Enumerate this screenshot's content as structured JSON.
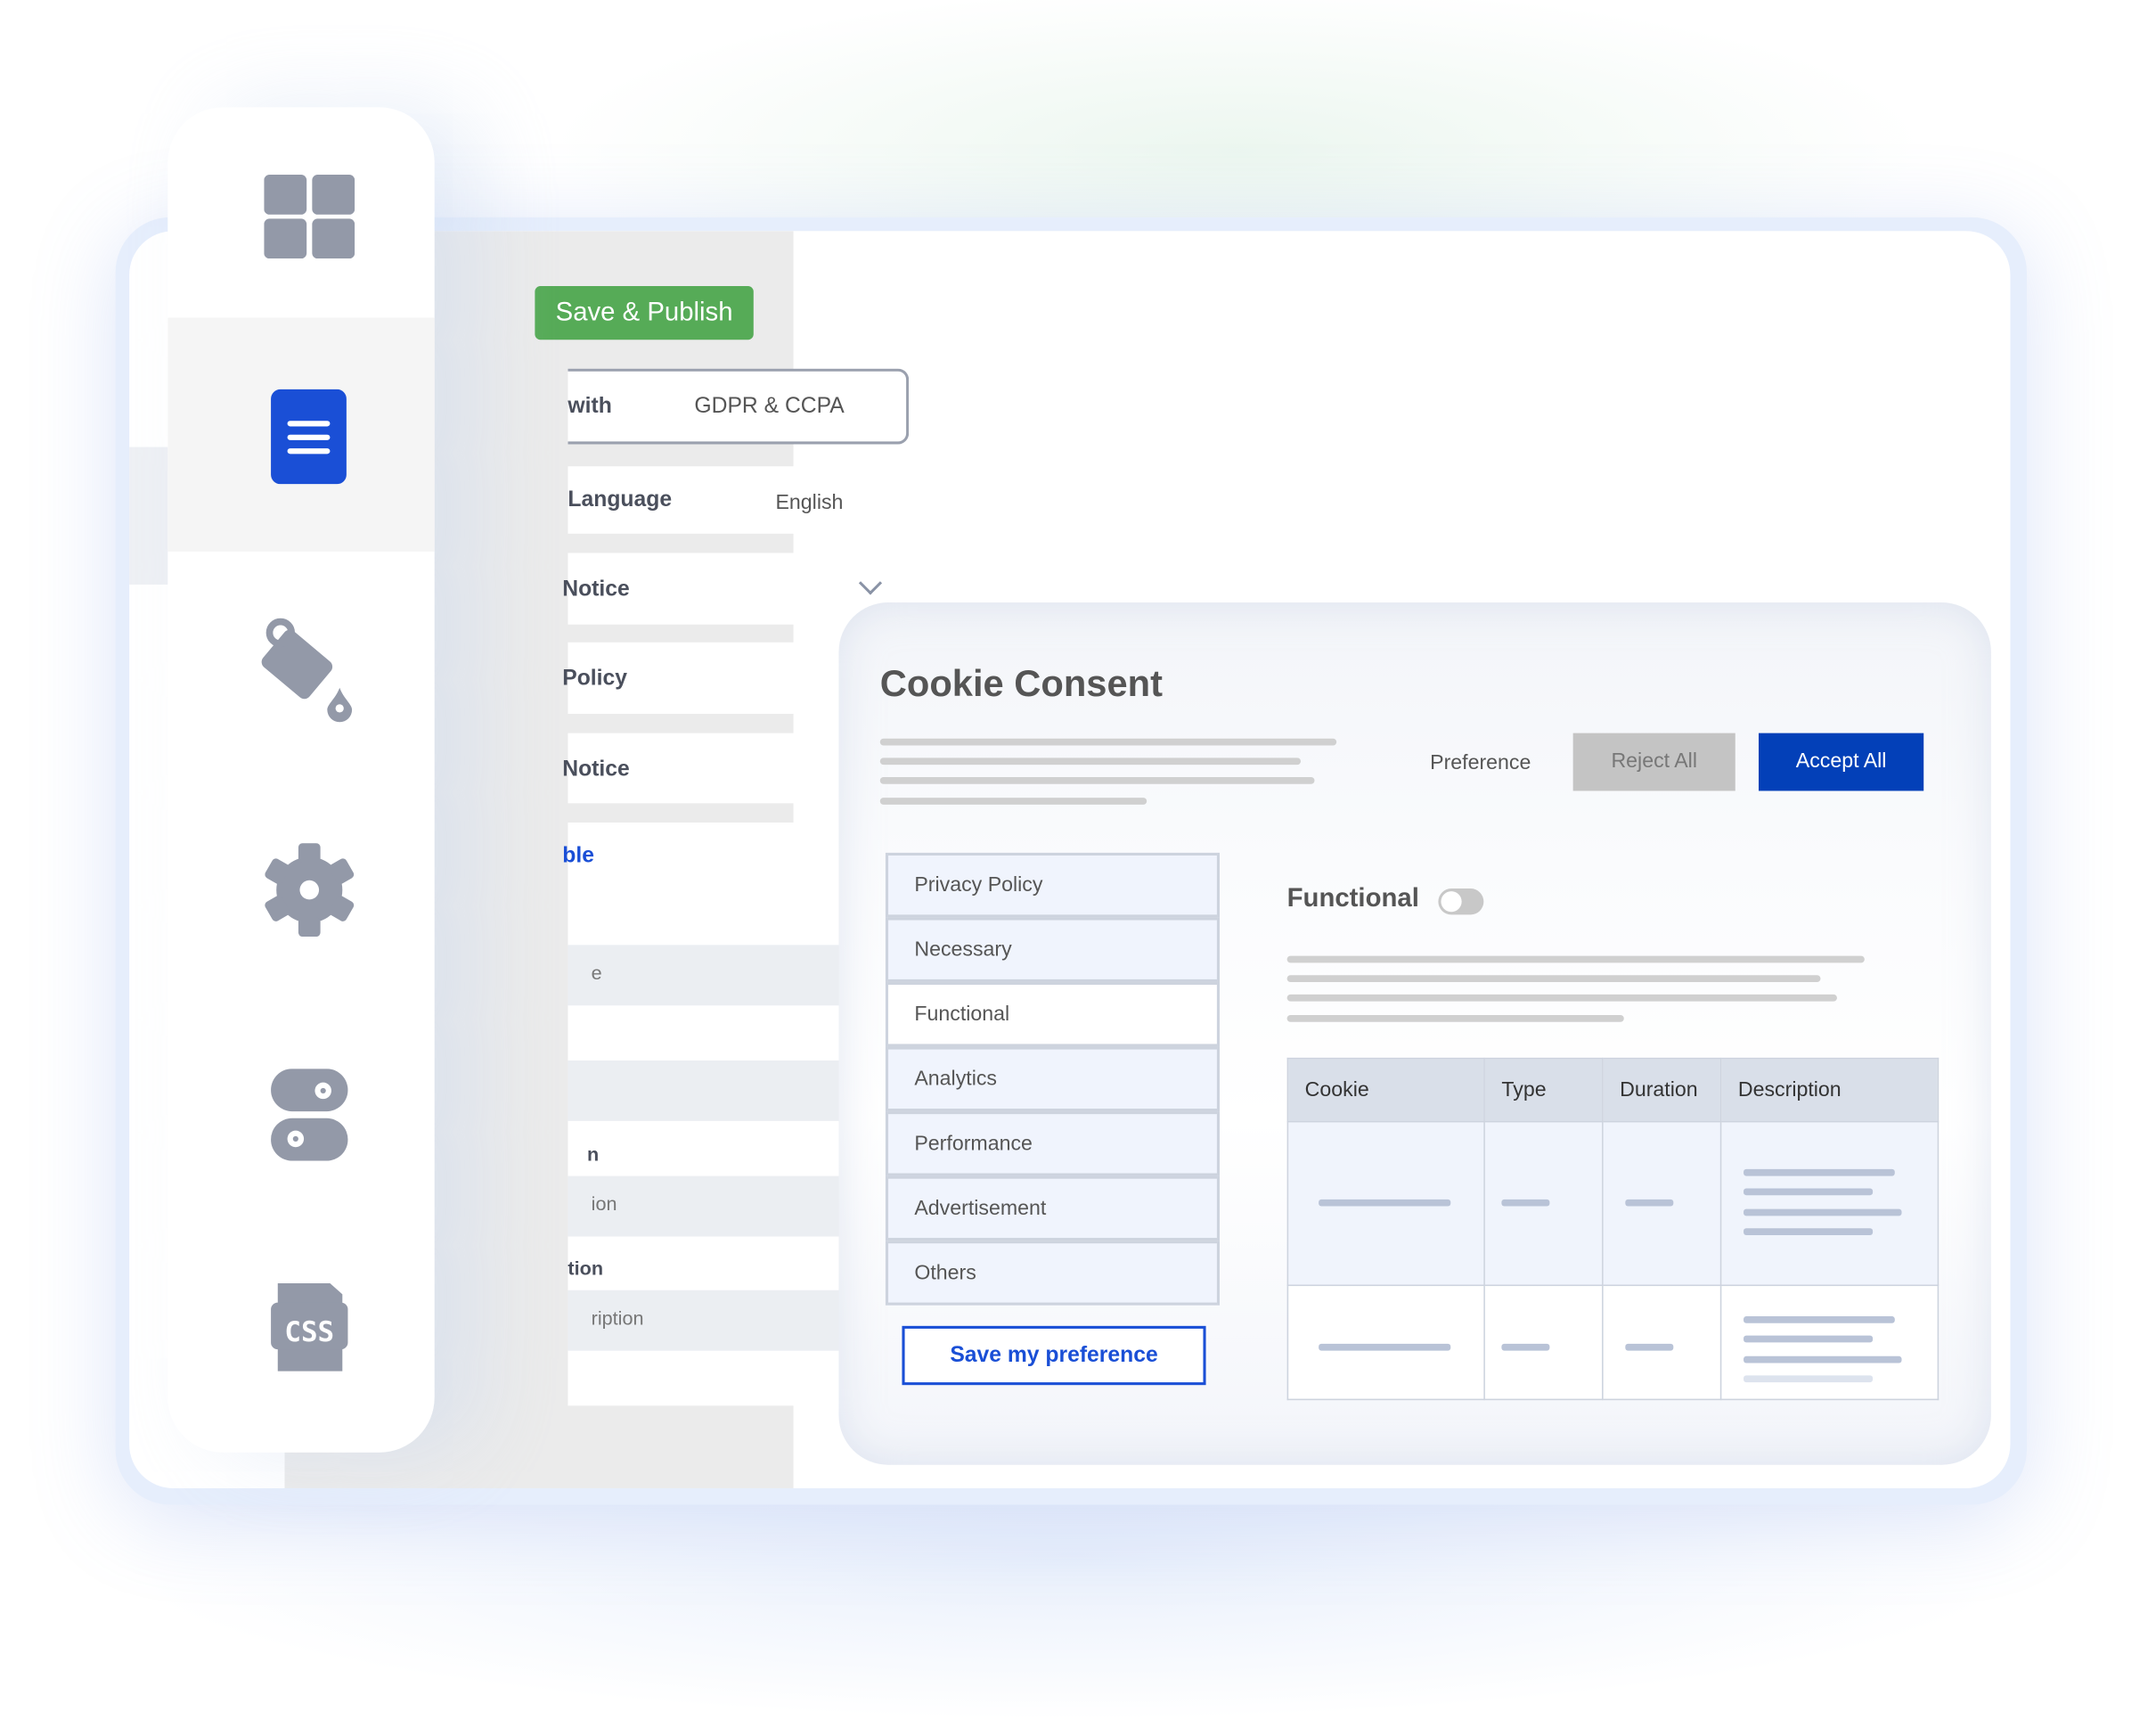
{
  "toolbar": {
    "save_publish": "Save & Publish"
  },
  "editor": {
    "compliance_label": "with",
    "compliance_value": "GDPR & CCPA",
    "language_label": "Language",
    "language_value": "English",
    "sections": [
      "Notice",
      "Policy",
      "Notice"
    ],
    "open_section": "ble",
    "fields": [
      {
        "value": "e"
      },
      {
        "label": "",
        "value": ""
      },
      {
        "label": "n",
        "value": "ion"
      },
      {
        "label": "tion",
        "value": "ription"
      }
    ]
  },
  "sidebar": {
    "icons": [
      "grid-icon",
      "document-list-icon",
      "paint-bucket-icon",
      "gear-icon",
      "toggles-icon",
      "css-file-icon"
    ],
    "active": 1,
    "css_text": "CSS"
  },
  "preview": {
    "title": "Cookie Consent",
    "preference": "Preference",
    "reject": "Reject All",
    "accept": "Accept All",
    "categories": [
      "Privacy Policy",
      "Necessary",
      "Functional",
      "Analytics",
      "Performance",
      "Advertisement",
      "Others"
    ],
    "selected_category": "Functional",
    "detail_title": "Functional",
    "toggle_on": false,
    "save_pref": "Save my preference",
    "table_headers": [
      "Cookie",
      "Type",
      "Duration",
      "Description"
    ]
  },
  "colors": {
    "green": "#56ab57",
    "accent": "#1a4fd6",
    "accept": "#0340b8",
    "reject": "#c4c4c4",
    "icon": "#9399a8"
  }
}
